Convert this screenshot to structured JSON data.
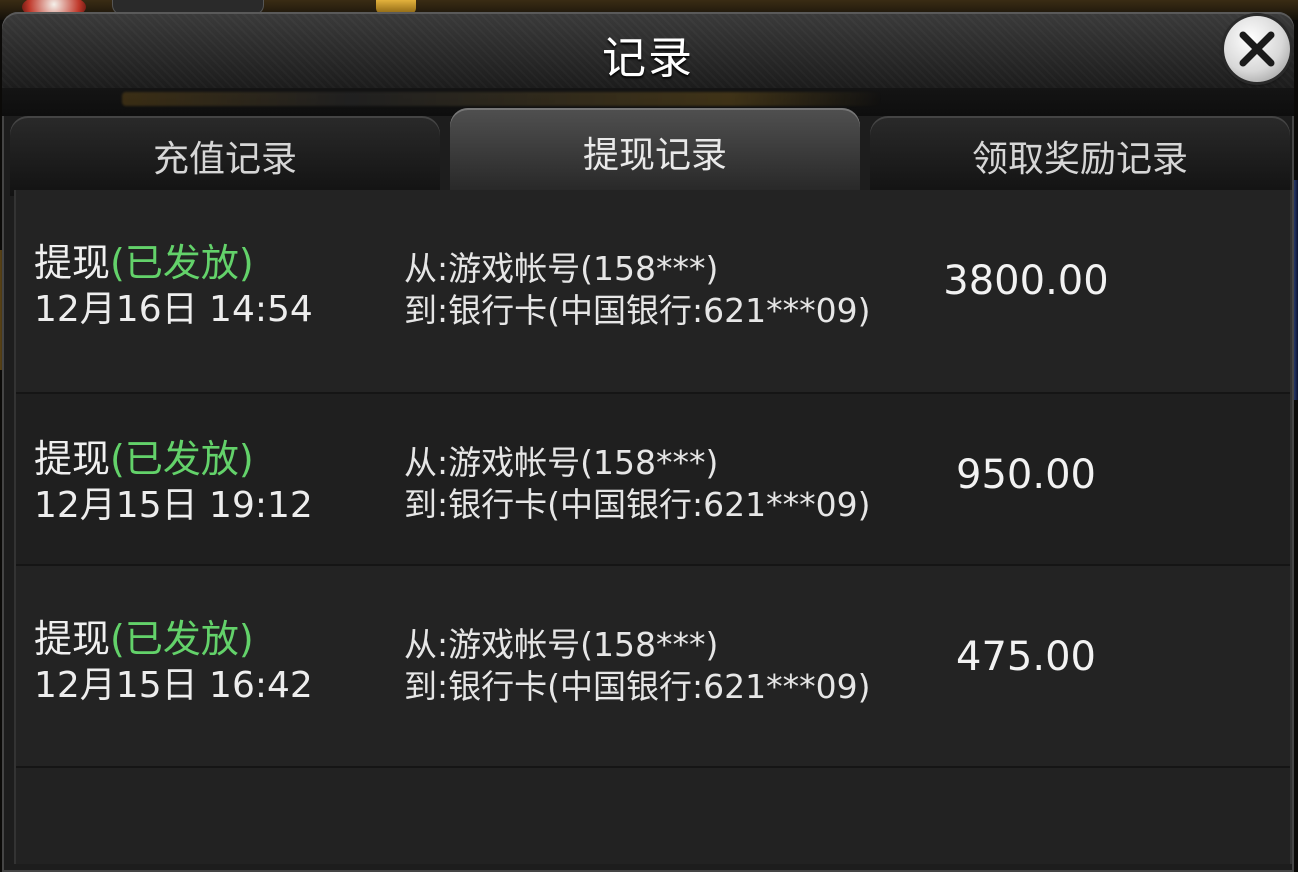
{
  "dialog": {
    "title": "记录",
    "close_icon": "close-icon"
  },
  "tabs": [
    {
      "label": "充值记录",
      "active": false
    },
    {
      "label": "提现记录",
      "active": true
    },
    {
      "label": "领取奖励记录",
      "active": false
    }
  ],
  "records": [
    {
      "type": "提现",
      "status": "(已发放)",
      "datetime": "12月16日 14:54",
      "from": "从:游戏帐号(158***)",
      "to": "到:银行卡(中国银行:621***09)",
      "amount": "3800.00"
    },
    {
      "type": "提现",
      "status": "(已发放)",
      "datetime": "12月15日 19:12",
      "from": "从:游戏帐号(158***)",
      "to": "到:银行卡(中国银行:621***09)",
      "amount": "950.00"
    },
    {
      "type": "提现",
      "status": "(已发放)",
      "datetime": "12月15日 16:42",
      "from": "从:游戏帐号(158***)",
      "to": "到:银行卡(中国银行:621***09)",
      "amount": "475.00"
    }
  ],
  "colors": {
    "status_green": "#63d26a",
    "panel": "#222222",
    "header": "#2e2e2e"
  }
}
